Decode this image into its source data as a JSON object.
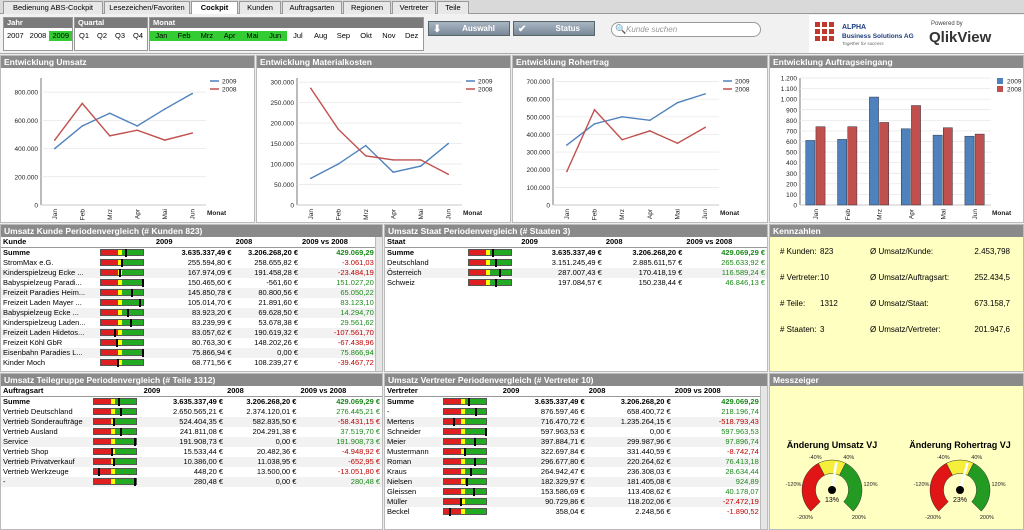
{
  "tabs": [
    "Bedienung ABS-Cockpit",
    "Lesezeichen/Favoriten",
    "Cockpit",
    "Kunden",
    "Auftragsarten",
    "Regionen",
    "Vertreter",
    "Teile"
  ],
  "filters": {
    "jahr": {
      "title": "Jahr",
      "items": [
        "2007",
        "2008",
        "2009"
      ]
    },
    "quartal": {
      "title": "Quartal",
      "items": [
        "Q1",
        "Q2",
        "Q3",
        "Q4"
      ]
    },
    "monat": {
      "title": "Monat",
      "items": [
        "Jan",
        "Feb",
        "Mrz",
        "Apr",
        "Mai",
        "Jun",
        "Jul",
        "Aug",
        "Sep",
        "Okt",
        "Nov",
        "Dez"
      ]
    }
  },
  "buttons": {
    "auswahl": "Auswahl",
    "status": "Status"
  },
  "search": {
    "placeholder": "Kunde suchen"
  },
  "logo": {
    "company_line1": "ALPHA",
    "company_line2": "Business Solutions AG",
    "tagline": "Together for success",
    "powered": "Powered by",
    "product": "QlikView"
  },
  "colors": {
    "s2009": "#4f81bd",
    "s2008": "#c0504d"
  },
  "charts": {
    "umsatz": {
      "title": "Entwicklung Umsatz"
    },
    "material": {
      "title": "Entwicklung Materialkosten"
    },
    "rohertrag": {
      "title": "Entwicklung Rohertrag"
    },
    "auftrag": {
      "title": "Entwicklung Auftragseingang"
    }
  },
  "chart_data": [
    {
      "type": "line",
      "title": "Entwicklung Umsatz",
      "xlabel": "Monat",
      "ylabel": "",
      "categories": [
        "Jan",
        "Feb",
        "Mrz",
        "Apr",
        "Mai",
        "Jun"
      ],
      "yticks": [
        "0",
        "200.000",
        "400.000",
        "600.000",
        "800.000"
      ],
      "ylim": [
        0,
        900000
      ],
      "legend": "top-right",
      "series": [
        {
          "name": "2009",
          "values": [
            400000,
            560000,
            650000,
            560000,
            680000,
            790000
          ]
        },
        {
          "name": "2008",
          "values": [
            460000,
            720000,
            490000,
            530000,
            460000,
            510000
          ]
        }
      ]
    },
    {
      "type": "line",
      "title": "Entwicklung Materialkosten",
      "xlabel": "Monat",
      "ylabel": "",
      "categories": [
        "Jan",
        "Feb",
        "Mrz",
        "Apr",
        "Mai",
        "Jun"
      ],
      "yticks": [
        "0",
        "50.000",
        "100.000",
        "150.000",
        "200.000",
        "250.000",
        "300.000"
      ],
      "ylim": [
        0,
        310000
      ],
      "legend": "top-right",
      "series": [
        {
          "name": "2009",
          "values": [
            65000,
            100000,
            145000,
            80000,
            95000,
            150000
          ]
        },
        {
          "name": "2008",
          "values": [
            285000,
            185000,
            120000,
            110000,
            110000,
            75000
          ]
        }
      ]
    },
    {
      "type": "line",
      "title": "Entwicklung Rohertrag",
      "xlabel": "Monat",
      "ylabel": "",
      "categories": [
        "Jan",
        "Feb",
        "Mrz",
        "Apr",
        "Mai",
        "Jun"
      ],
      "yticks": [
        "0",
        "100.000",
        "200.000",
        "300.000",
        "400.000",
        "500.000",
        "600.000",
        "700.000"
      ],
      "ylim": [
        0,
        720000
      ],
      "legend": "top-right",
      "series": [
        {
          "name": "2009",
          "values": [
            340000,
            460000,
            500000,
            480000,
            580000,
            630000
          ]
        },
        {
          "name": "2008",
          "values": [
            190000,
            540000,
            370000,
            420000,
            350000,
            440000
          ]
        }
      ]
    },
    {
      "type": "bar",
      "title": "Entwicklung Auftragseingang",
      "xlabel": "Monat",
      "ylabel": "",
      "categories": [
        "Jan",
        "Feb",
        "Mrz",
        "Apr",
        "Mai",
        "Jun"
      ],
      "yticks": [
        "0",
        "100",
        "200",
        "300",
        "400",
        "500",
        "600",
        "700",
        "800",
        "900",
        "1.000",
        "1.100",
        "1.200"
      ],
      "ylim": [
        0,
        1200
      ],
      "legend": "top-right",
      "series": [
        {
          "name": "2009",
          "values": [
            610,
            620,
            1020,
            720,
            660,
            650
          ]
        },
        {
          "name": "2008",
          "values": [
            740,
            740,
            780,
            940,
            730,
            670
          ]
        }
      ]
    }
  ],
  "kunden": {
    "title": "Umsatz Kunde Periodenvergleich (# Kunden 823)",
    "h": [
      "Kunde",
      "2009",
      "2008",
      "2009 vs 2008"
    ],
    "sum": [
      "Summe",
      "3.635.337,49 €",
      "3.206.268,20 €",
      "429.069,29 €"
    ],
    "rows": [
      [
        "StromMax e.G.",
        "255.594,80 €",
        "258.655,82 €",
        "-3.061,03 €",
        0.47
      ],
      [
        "Kinderspielzeug Ecke ...",
        "167.974,09 €",
        "191.458,28 €",
        "-23.484,19 €",
        0.42
      ],
      [
        "Babyspielzeug Paradi...",
        "150.465,60 €",
        "-561,60 €",
        "151.027,20 €",
        0.96
      ],
      [
        "Freizeit Paradies Heim...",
        "145.850,78 €",
        "80.800,56 €",
        "65.050,22 €",
        0.7
      ],
      [
        "Freizeit Laden Mayer ...",
        "105.014,70 €",
        "21.891,60 €",
        "83.123,10 €",
        0.9
      ],
      [
        "Babyspielzeug Ecke ...",
        "83.923,20 €",
        "69.628,50 €",
        "14.294,70 €",
        0.6
      ],
      [
        "Kinderspielzeug Laden...",
        "83.239,99 €",
        "53.678,38 €",
        "29.561,62 €",
        0.68
      ],
      [
        "Freizeit Laden Hidetos...",
        "83.057,62 €",
        "190.619,32 €",
        "-107.561,70 €",
        0.3
      ],
      [
        "Freizeit  Köhl GbR",
        "80.763,30 €",
        "148.202,26 €",
        "-67.438,96 €",
        0.35
      ],
      [
        "Eisenbahn Paradies L...",
        "75.866,94 €",
        "0,00 €",
        "75.866,94 €",
        0.96
      ],
      [
        "Kinder  Moch",
        "68.771,56 €",
        "108.239,27 €",
        "-39.467,72 €",
        0.38
      ]
    ]
  },
  "staaten": {
    "title": "Umsatz Staat Periodenvergleich (# Staaten 3)",
    "h": [
      "Staat",
      "2009",
      "2008",
      "2009 vs 2008"
    ],
    "sum": [
      "Summe",
      "3.635.337,49 €",
      "3.206.268,20 €",
      "429.069,29 €"
    ],
    "rows": [
      [
        "Deutschland",
        "3.151.245,49 €",
        "2.885.611,57 €",
        "265.633,92 €",
        0.62
      ],
      [
        "Österreich",
        "287.007,43 €",
        "170.418,19 €",
        "116.589,24 €",
        0.72
      ],
      [
        "Schweiz",
        "197.084,57 €",
        "150.238,44 €",
        "46.846,13 €",
        0.64
      ]
    ]
  },
  "teile": {
    "title": "Umsatz Teilegruppe Periodenvergleich (# Teile 1312)",
    "h": [
      "Auftragsart",
      "2009",
      "2008",
      "2009 vs 2008"
    ],
    "sum": [
      "Summe",
      "3.635.337,49 €",
      "3.206.268,20 €",
      "429.069,29 €"
    ],
    "rows": [
      [
        "Vertrieb Deutschland",
        "2.650.565,21 €",
        "2.374.120,01 €",
        "276.445,21 €",
        0.62
      ],
      [
        "Vertrieb Sonderaufträge",
        "524.404,35 €",
        "582.835,50 €",
        "-58.431,15 €",
        0.45
      ],
      [
        "Vertrieb Ausland",
        "241.811,08 €",
        "204.291,38 €",
        "37.519,70 €",
        0.62
      ],
      [
        "Service",
        "191.908,73 €",
        "0,00 €",
        "191.908,73 €",
        0.96
      ],
      [
        "Vertrieb Shop",
        "15.533,44 €",
        "20.482,36 €",
        "-4.948,92 €",
        0.42
      ],
      [
        "Vertrieb Privatverkauf",
        "10.386,00 €",
        "11.038,95 €",
        "-652,95 €",
        0.47
      ],
      [
        "Vertrieb Werkzeuge",
        "448,20 €",
        "13.500,00 €",
        "-13.051,80 €",
        0.1
      ],
      [
        "-",
        "280,48 €",
        "0,00 €",
        "280,48 €",
        0.96
      ]
    ]
  },
  "vertreter": {
    "title": "Umsatz Vertreter Periodenvergleich (# Vertreter 10)",
    "h": [
      "Vertreter",
      "2009",
      "2008",
      "2009 vs 2008"
    ],
    "sum": [
      "Summe",
      "3.635.337,49 €",
      "3.206.268,20 €",
      "429.069,29 €"
    ],
    "rows": [
      [
        "-",
        "876.597,46 €",
        "658.400,72 €",
        "218.196,74 €",
        0.72
      ],
      [
        "Mertens",
        "716.470,72 €",
        "1.235.264,15 €",
        "-518.793,43 €",
        0.2
      ],
      [
        "Schneider",
        "597.963,53 €",
        "0,00 €",
        "597.963,53 €",
        0.96
      ],
      [
        "Meier",
        "397.884,71 €",
        "299.987,96 €",
        "97.896,74 €",
        0.7
      ],
      [
        "Mustermann",
        "322.697,84 €",
        "331.440,59 €",
        "-8.742,74 €",
        0.48
      ],
      [
        "Roman",
        "296.677,80 €",
        "220.264,62 €",
        "76.413,18 €",
        0.7
      ],
      [
        "Kraus",
        "264.942,47 €",
        "236.308,03 €",
        "28.634,44 €",
        0.6
      ],
      [
        "Nielsen",
        "182.329,97 €",
        "181.405,08 €",
        "924,89 €",
        0.51
      ],
      [
        "Gleissen",
        "153.586,69 €",
        "113.408,62 €",
        "40.178,07 €",
        0.68
      ],
      [
        "Müller",
        "90.729,86 €",
        "118.202,06 €",
        "-27.472,19 €",
        0.38
      ],
      [
        "Beckel",
        "358,04 €",
        "2.248,56 €",
        "-1.890,52 €",
        0.1
      ]
    ]
  },
  "kennzahlen": {
    "title": "Kennzahlen",
    "items": [
      {
        "l": "# Kunden:",
        "v": "823",
        "l2": "Ø Umsatz/Kunde:",
        "v2": "2.453,798"
      },
      {
        "l": "# Vertreter:",
        "v": "10",
        "l2": "Ø Umsatz/Auftragsart:",
        "v2": "252.434,5"
      },
      {
        "l": "# Teile:",
        "v": "1312",
        "l2": "Ø Umsatz/Staat:",
        "v2": "673.158,7"
      },
      {
        "l": "# Staaten:",
        "v": "3",
        "l2": "Ø Umsatz/Vertreter:",
        "v2": "201.947,6"
      }
    ]
  },
  "messzeiger": {
    "title": "Messzeiger",
    "g1": {
      "label": "Änderung Umsatz VJ",
      "value": "13%",
      "pct": 13,
      "t_m40": "-40%",
      "t_40": "40%",
      "t_m120": "-120%",
      "t_120": "120%",
      "t_m200": "-200%",
      "t_200": "200%"
    },
    "g2": {
      "label": "Änderung Rohertrag VJ",
      "value": "23%",
      "pct": 23,
      "t_m40": "-40%",
      "t_40": "40%",
      "t_m120": "-120%",
      "t_120": "120%",
      "t_m200": "-200%",
      "t_200": "200%"
    }
  }
}
